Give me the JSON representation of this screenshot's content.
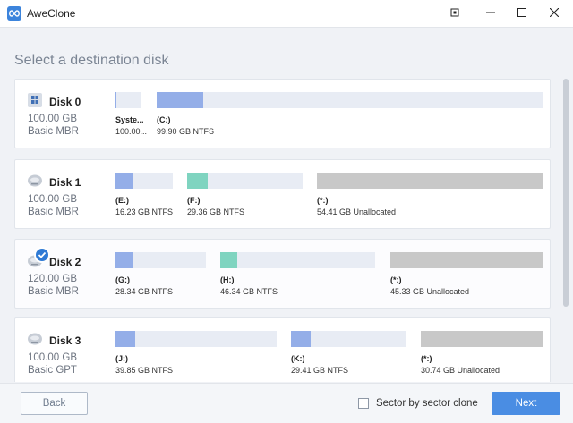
{
  "window": {
    "title": "AweClone"
  },
  "heading": "Select a destination disk",
  "colors": {
    "used": "#94aee8",
    "used_alt": "#7fd4c0",
    "unallocated": "#c8c8c8",
    "track": "#e8ecf4",
    "accent": "#2f7ad5"
  },
  "disks": [
    {
      "name": "Disk 0",
      "size": "100.00 GB",
      "type": "Basic MBR",
      "icon": "windows-disk-icon",
      "selected": false,
      "partitions": [
        {
          "label": "Syste...",
          "info": "100.00...",
          "color": "used",
          "fill": 0.05
        },
        {
          "label": "(C:)",
          "info": "99.90 GB NTFS",
          "color": "used",
          "fill": 0.12
        }
      ]
    },
    {
      "name": "Disk 1",
      "size": "100.00 GB",
      "type": "Basic MBR",
      "icon": "hard-disk-icon",
      "selected": false,
      "partitions": [
        {
          "label": "(E:)",
          "info": "16.23 GB NTFS",
          "color": "used",
          "fill": 0.3
        },
        {
          "label": "(F:)",
          "info": "29.36 GB NTFS",
          "color": "used_alt",
          "fill": 0.18
        },
        {
          "label": "(*:)",
          "info": "54.41 GB Unallocated",
          "color": "unallocated",
          "fill": 1.0
        }
      ]
    },
    {
      "name": "Disk 2",
      "size": "120.00 GB",
      "type": "Basic MBR",
      "icon": "hard-disk-icon",
      "selected": true,
      "partitions": [
        {
          "label": "(G:)",
          "info": "28.34 GB NTFS",
          "color": "used",
          "fill": 0.19
        },
        {
          "label": "(H:)",
          "info": "46.34 GB NTFS",
          "color": "used_alt",
          "fill": 0.11
        },
        {
          "label": "(*:)",
          "info": "45.33 GB Unallocated",
          "color": "unallocated",
          "fill": 1.0
        }
      ]
    },
    {
      "name": "Disk 3",
      "size": "100.00 GB",
      "type": "Basic GPT",
      "icon": "hard-disk-icon",
      "selected": false,
      "partitions": [
        {
          "label": "(J:)",
          "info": "39.85 GB NTFS",
          "color": "used",
          "fill": 0.12
        },
        {
          "label": "(K:)",
          "info": "29.41 GB NTFS",
          "color": "used",
          "fill": 0.17
        },
        {
          "label": "(*:)",
          "info": "30.74 GB Unallocated",
          "color": "unallocated",
          "fill": 1.0
        }
      ]
    }
  ],
  "footer": {
    "back_label": "Back",
    "sector_label": "Sector by sector clone",
    "sector_checked": false,
    "next_label": "Next"
  }
}
